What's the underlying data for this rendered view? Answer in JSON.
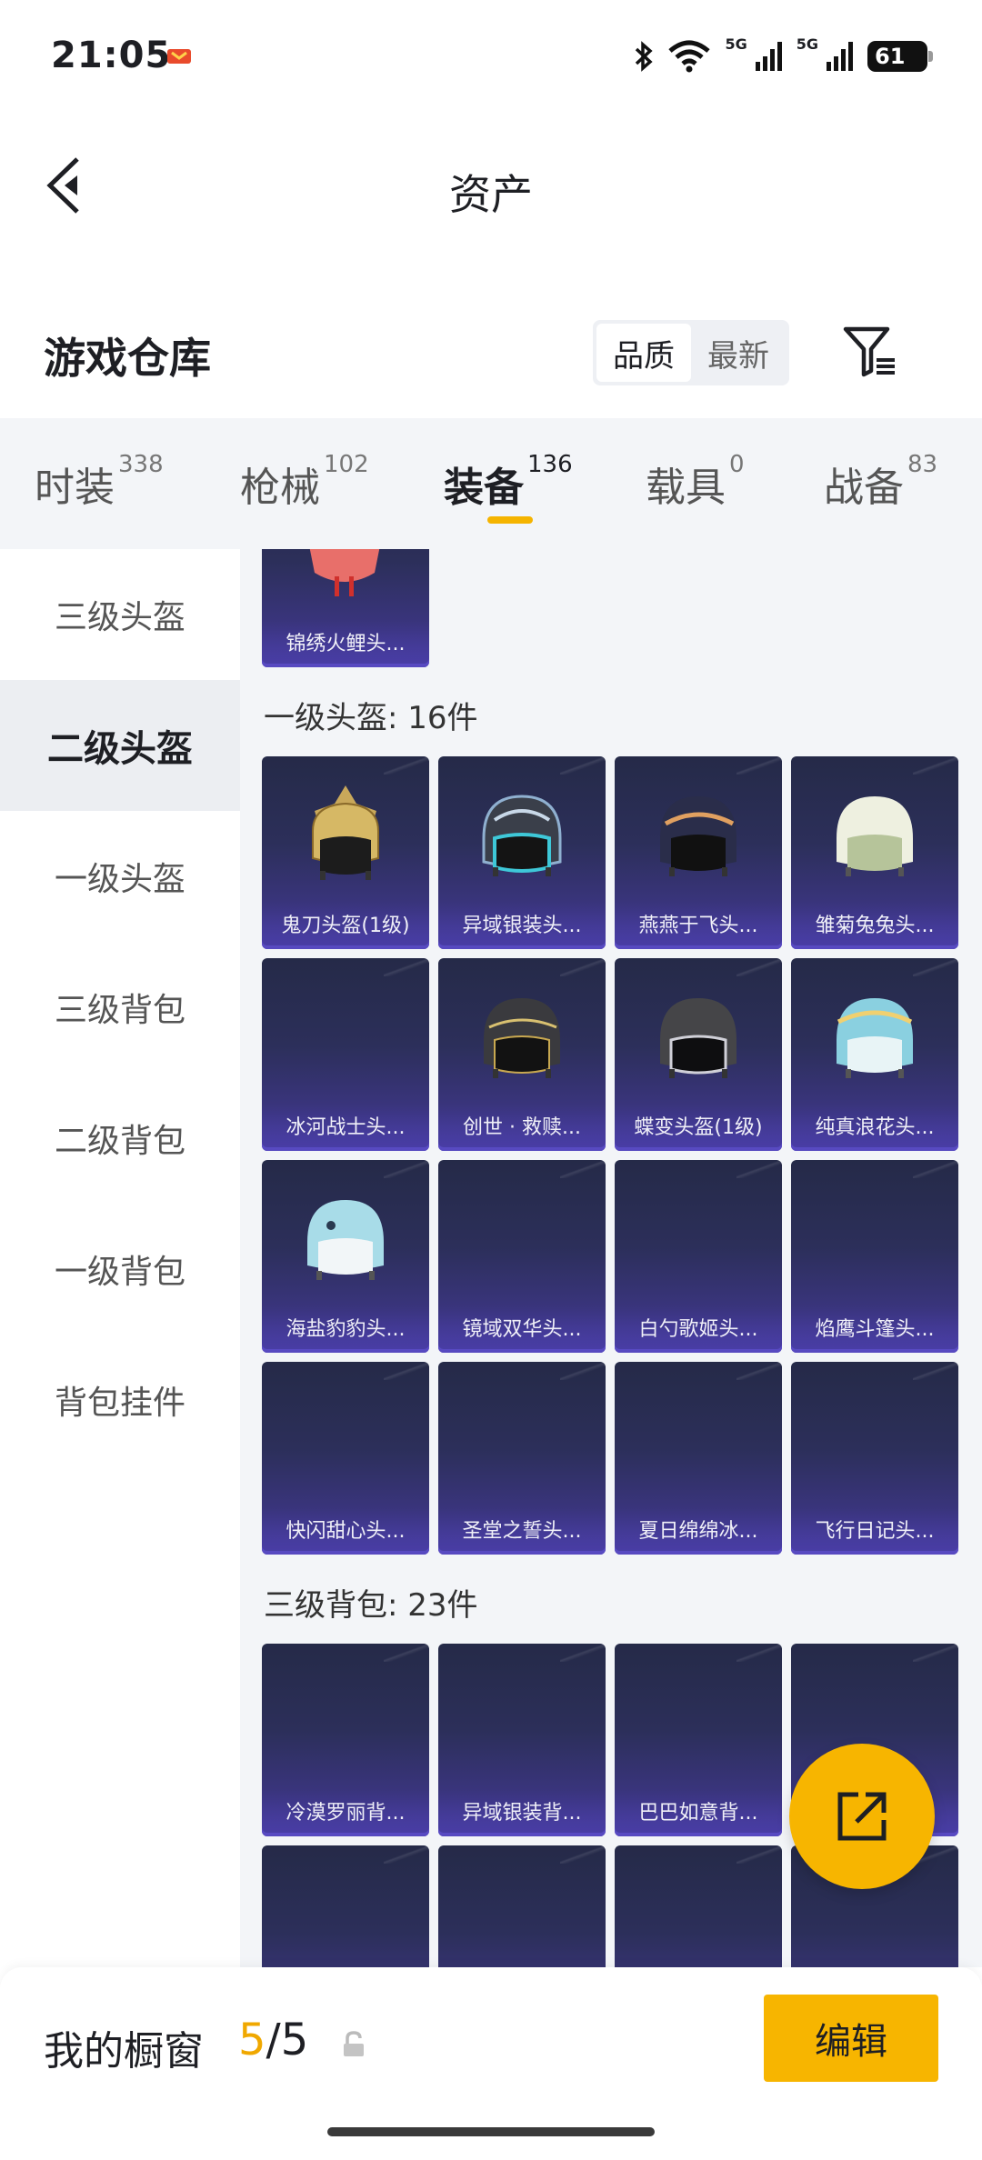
{
  "status": {
    "time": "21:05",
    "net1": "5G",
    "net2": "5G",
    "battery": "61"
  },
  "header": {
    "title": "资产"
  },
  "warehouse": {
    "title": "游戏仓库",
    "sort_quality": "品质",
    "sort_newest": "最新"
  },
  "tabs": [
    {
      "label": "时装",
      "count": "338"
    },
    {
      "label": "枪械",
      "count": "102"
    },
    {
      "label": "装备",
      "count": "136"
    },
    {
      "label": "载具",
      "count": "0"
    },
    {
      "label": "战备",
      "count": "83"
    }
  ],
  "sidebar": [
    "三级头盔",
    "二级头盔",
    "一级头盔",
    "三级背包",
    "二级背包",
    "一级背包",
    "背包挂件"
  ],
  "content": {
    "top_partial_item": "锦绣火鲤头...",
    "section_level1_helmet": "一级头盔: 16件",
    "level1_helmets": [
      "鬼刀头盔(1级)",
      "异域银装头...",
      "燕燕于飞头...",
      "雏菊兔兔头...",
      "冰河战士头...",
      "创世 · 救赎...",
      "蝶变头盔(1级)",
      "纯真浪花头...",
      "海盐豹豹头...",
      "镜域双华头...",
      "白勺歌姬头...",
      "焰鹰斗篷头...",
      "快闪甜心头...",
      "圣堂之誓头...",
      "夏日绵绵冰...",
      "飞行日记头..."
    ],
    "section_level3_backpack": "三级背包: 23件",
    "level3_backpacks": [
      "冷漠罗丽背...",
      "异域银装背...",
      "巴巴如意背..."
    ]
  },
  "bottom": {
    "window_label": "我的橱窗",
    "window_current": "5",
    "window_sep": "/",
    "window_total": "5",
    "edit_label": "编辑"
  },
  "colors": {
    "accent": "#f7b500",
    "card_top": "#252a48",
    "card_bottom": "#4c3fa0",
    "tab_underline": "#f5b400"
  }
}
